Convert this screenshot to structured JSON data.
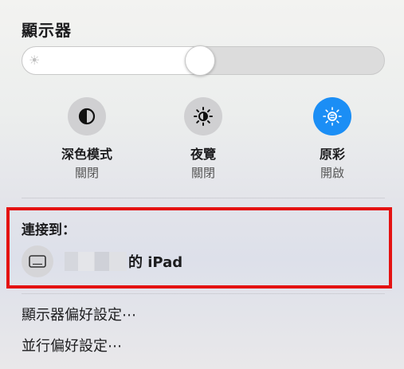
{
  "panel": {
    "title": "顯示器",
    "brightness": 0.49
  },
  "controls": [
    {
      "label": "深色模式",
      "status": "關閉",
      "icon": "dark-mode-icon",
      "active": false
    },
    {
      "label": "夜覽",
      "status": "關閉",
      "icon": "night-shift-icon",
      "active": false
    },
    {
      "label": "原彩",
      "status": "開啟",
      "icon": "true-tone-icon",
      "active": true
    }
  ],
  "connect": {
    "title": "連接到：",
    "device_name": "的 iPad",
    "device_icon": "ipad-icon"
  },
  "menu": {
    "display_prefs": "顯示器偏好設定⋯",
    "sidecar_prefs": "並行偏好設定⋯"
  },
  "colors": {
    "accent": "#1b8ef5",
    "highlight_box": "#e41212"
  }
}
